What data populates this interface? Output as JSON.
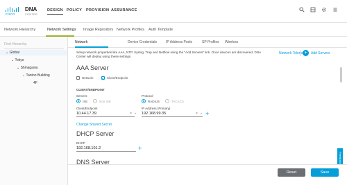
{
  "brand": {
    "cisco": "cisco",
    "dna": "DNA",
    "center": "CENTER"
  },
  "topnav": {
    "design": "DESIGN",
    "policy": "POLICY",
    "provision": "PROVISION",
    "assurance": "ASSURANCE"
  },
  "topicons": [
    "search-icon",
    "apps-icon",
    "gear-icon",
    "menu-icon"
  ],
  "tabs": [
    "Network Hierarchy",
    "Network Settings",
    "Image Repository",
    "Network Profiles",
    "Auth Template"
  ],
  "tree": {
    "find_placeholder": "Find Hierarchy",
    "items": [
      "Global",
      "Tokyo",
      "Shinagawa",
      "Tanton Building",
      "4F"
    ]
  },
  "subtabs": [
    "Network",
    "Device Credentials",
    "IP Address Pools",
    "SP Profiles",
    "Wireless"
  ],
  "description": "Setup network properties like AAA, NTP, Syslog, Trap and Netflow using the \"Add Servers\" link. Once devices are discovered, DNA Center will deploy using these settings.",
  "network_telemetry": "Network Telemetry",
  "add_servers": "Add Servers",
  "aaa": {
    "title": "AAA Server",
    "opt_network": "Network",
    "opt_client": "Client/Endpoint",
    "section": "CLIENT/ENDPOINT",
    "servers_label": "Servers",
    "ise": "ISE",
    "non_ise": "Non ISE",
    "protocol_label": "Protocol",
    "radius": "RADIUS",
    "tacacs": "TACACS",
    "client_label": "Client/Endpoint",
    "client_value": "10.44.17.39",
    "ip_label": "IP Address (Primary)",
    "ip_value": "192.168.99.35",
    "change_secret": "Change Shared Secret"
  },
  "dhcp": {
    "title": "DHCP Server",
    "label": "DHCP",
    "value": "192.168.101.2"
  },
  "dns": {
    "title": "DNS Server"
  },
  "footer": {
    "reset": "Reset",
    "save": "Save"
  },
  "feedback": "Feedback",
  "colors": {
    "accent": "#049fd9",
    "tab_accent": "#9ab32b",
    "reset": "#6b6f73"
  }
}
